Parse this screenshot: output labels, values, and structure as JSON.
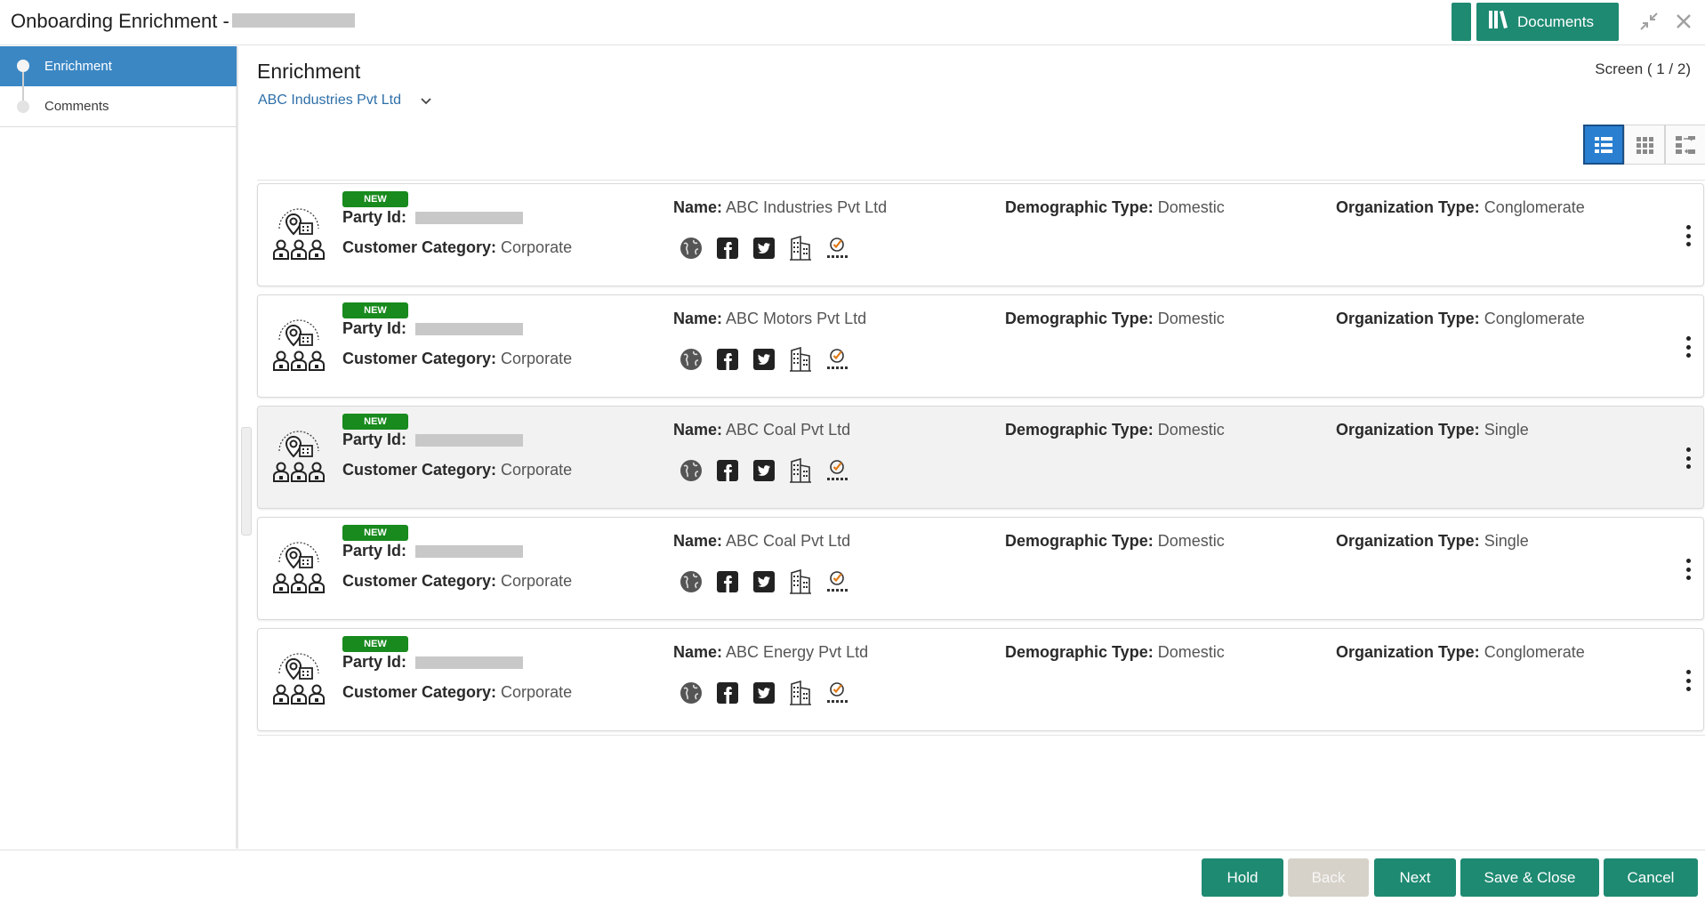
{
  "header": {
    "title": "Onboarding Enrichment -",
    "documents_label": "Documents"
  },
  "sidebar": {
    "items": [
      {
        "label": "Enrichment"
      },
      {
        "label": "Comments"
      }
    ]
  },
  "main": {
    "title": "Enrichment",
    "screen_indicator": "Screen ( 1 / 2)",
    "selected_party": "ABC Industries Pvt Ltd"
  },
  "labels": {
    "party_id": "Party Id:",
    "customer_category": "Customer Category:",
    "name": "Name:",
    "demographic_type": "Demographic Type:",
    "organization_type": "Organization Type:"
  },
  "cards": [
    {
      "badge": "NEW",
      "customer_category": "Corporate",
      "name": "ABC Industries Pvt Ltd",
      "demographic_type": "Domestic",
      "organization_type": "Conglomerate"
    },
    {
      "badge": "NEW",
      "customer_category": "Corporate",
      "name": "ABC Motors Pvt Ltd",
      "demographic_type": "Domestic",
      "organization_type": "Conglomerate"
    },
    {
      "badge": "NEW",
      "customer_category": "Corporate",
      "name": "ABC Coal Pvt Ltd",
      "demographic_type": "Domestic",
      "organization_type": "Single"
    },
    {
      "badge": "NEW",
      "customer_category": "Corporate",
      "name": "ABC Coal Pvt Ltd",
      "demographic_type": "Domestic",
      "organization_type": "Single"
    },
    {
      "badge": "NEW",
      "customer_category": "Corporate",
      "name": "ABC Energy Pvt Ltd",
      "demographic_type": "Domestic",
      "organization_type": "Conglomerate"
    }
  ],
  "card_icons": [
    "globe-icon",
    "facebook-icon",
    "twitter-icon",
    "building-icon",
    "rating-icon"
  ],
  "footer": {
    "hold": "Hold",
    "back": "Back",
    "next": "Next",
    "save_close": "Save & Close",
    "cancel": "Cancel"
  },
  "colors": {
    "primary": "#1e8a72",
    "sidebar_active": "#3b87c4",
    "badge_new": "#188a1e",
    "link": "#2e6fa8",
    "disabled": "#d7d2c9"
  }
}
